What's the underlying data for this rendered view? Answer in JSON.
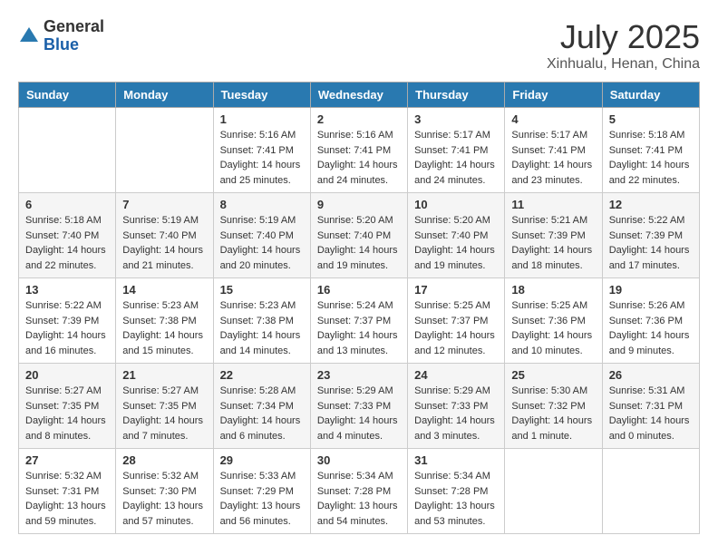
{
  "logo": {
    "general": "General",
    "blue": "Blue"
  },
  "title": "July 2025",
  "subtitle": "Xinhualu, Henan, China",
  "days_of_week": [
    "Sunday",
    "Monday",
    "Tuesday",
    "Wednesday",
    "Thursday",
    "Friday",
    "Saturday"
  ],
  "weeks": [
    [
      {
        "day": "",
        "info": ""
      },
      {
        "day": "",
        "info": ""
      },
      {
        "day": "1",
        "info": "Sunrise: 5:16 AM\nSunset: 7:41 PM\nDaylight: 14 hours and 25 minutes."
      },
      {
        "day": "2",
        "info": "Sunrise: 5:16 AM\nSunset: 7:41 PM\nDaylight: 14 hours and 24 minutes."
      },
      {
        "day": "3",
        "info": "Sunrise: 5:17 AM\nSunset: 7:41 PM\nDaylight: 14 hours and 24 minutes."
      },
      {
        "day": "4",
        "info": "Sunrise: 5:17 AM\nSunset: 7:41 PM\nDaylight: 14 hours and 23 minutes."
      },
      {
        "day": "5",
        "info": "Sunrise: 5:18 AM\nSunset: 7:41 PM\nDaylight: 14 hours and 22 minutes."
      }
    ],
    [
      {
        "day": "6",
        "info": "Sunrise: 5:18 AM\nSunset: 7:40 PM\nDaylight: 14 hours and 22 minutes."
      },
      {
        "day": "7",
        "info": "Sunrise: 5:19 AM\nSunset: 7:40 PM\nDaylight: 14 hours and 21 minutes."
      },
      {
        "day": "8",
        "info": "Sunrise: 5:19 AM\nSunset: 7:40 PM\nDaylight: 14 hours and 20 minutes."
      },
      {
        "day": "9",
        "info": "Sunrise: 5:20 AM\nSunset: 7:40 PM\nDaylight: 14 hours and 19 minutes."
      },
      {
        "day": "10",
        "info": "Sunrise: 5:20 AM\nSunset: 7:40 PM\nDaylight: 14 hours and 19 minutes."
      },
      {
        "day": "11",
        "info": "Sunrise: 5:21 AM\nSunset: 7:39 PM\nDaylight: 14 hours and 18 minutes."
      },
      {
        "day": "12",
        "info": "Sunrise: 5:22 AM\nSunset: 7:39 PM\nDaylight: 14 hours and 17 minutes."
      }
    ],
    [
      {
        "day": "13",
        "info": "Sunrise: 5:22 AM\nSunset: 7:39 PM\nDaylight: 14 hours and 16 minutes."
      },
      {
        "day": "14",
        "info": "Sunrise: 5:23 AM\nSunset: 7:38 PM\nDaylight: 14 hours and 15 minutes."
      },
      {
        "day": "15",
        "info": "Sunrise: 5:23 AM\nSunset: 7:38 PM\nDaylight: 14 hours and 14 minutes."
      },
      {
        "day": "16",
        "info": "Sunrise: 5:24 AM\nSunset: 7:37 PM\nDaylight: 14 hours and 13 minutes."
      },
      {
        "day": "17",
        "info": "Sunrise: 5:25 AM\nSunset: 7:37 PM\nDaylight: 14 hours and 12 minutes."
      },
      {
        "day": "18",
        "info": "Sunrise: 5:25 AM\nSunset: 7:36 PM\nDaylight: 14 hours and 10 minutes."
      },
      {
        "day": "19",
        "info": "Sunrise: 5:26 AM\nSunset: 7:36 PM\nDaylight: 14 hours and 9 minutes."
      }
    ],
    [
      {
        "day": "20",
        "info": "Sunrise: 5:27 AM\nSunset: 7:35 PM\nDaylight: 14 hours and 8 minutes."
      },
      {
        "day": "21",
        "info": "Sunrise: 5:27 AM\nSunset: 7:35 PM\nDaylight: 14 hours and 7 minutes."
      },
      {
        "day": "22",
        "info": "Sunrise: 5:28 AM\nSunset: 7:34 PM\nDaylight: 14 hours and 6 minutes."
      },
      {
        "day": "23",
        "info": "Sunrise: 5:29 AM\nSunset: 7:33 PM\nDaylight: 14 hours and 4 minutes."
      },
      {
        "day": "24",
        "info": "Sunrise: 5:29 AM\nSunset: 7:33 PM\nDaylight: 14 hours and 3 minutes."
      },
      {
        "day": "25",
        "info": "Sunrise: 5:30 AM\nSunset: 7:32 PM\nDaylight: 14 hours and 1 minute."
      },
      {
        "day": "26",
        "info": "Sunrise: 5:31 AM\nSunset: 7:31 PM\nDaylight: 14 hours and 0 minutes."
      }
    ],
    [
      {
        "day": "27",
        "info": "Sunrise: 5:32 AM\nSunset: 7:31 PM\nDaylight: 13 hours and 59 minutes."
      },
      {
        "day": "28",
        "info": "Sunrise: 5:32 AM\nSunset: 7:30 PM\nDaylight: 13 hours and 57 minutes."
      },
      {
        "day": "29",
        "info": "Sunrise: 5:33 AM\nSunset: 7:29 PM\nDaylight: 13 hours and 56 minutes."
      },
      {
        "day": "30",
        "info": "Sunrise: 5:34 AM\nSunset: 7:28 PM\nDaylight: 13 hours and 54 minutes."
      },
      {
        "day": "31",
        "info": "Sunrise: 5:34 AM\nSunset: 7:28 PM\nDaylight: 13 hours and 53 minutes."
      },
      {
        "day": "",
        "info": ""
      },
      {
        "day": "",
        "info": ""
      }
    ]
  ]
}
